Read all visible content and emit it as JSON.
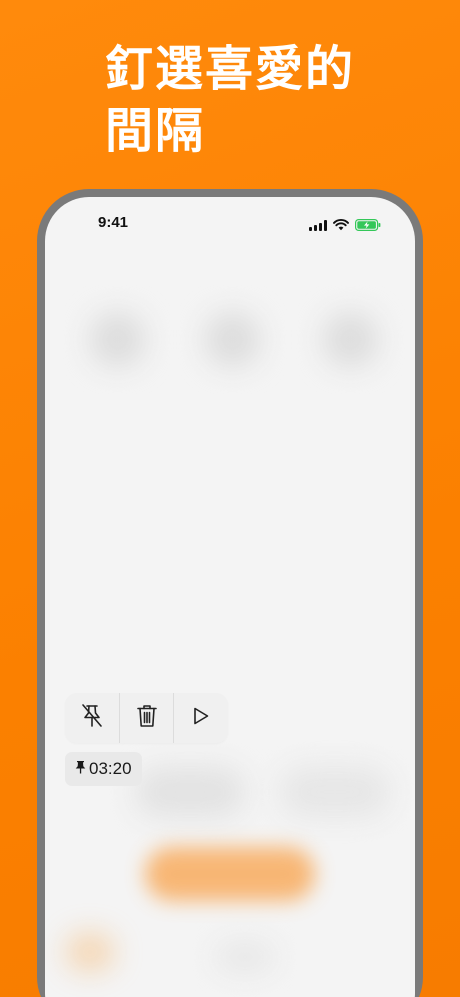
{
  "headline": {
    "line1": "釘選喜愛的",
    "line2": "間隔"
  },
  "status_bar": {
    "time": "9:41",
    "icons": [
      "cellular-signal-icon",
      "wifi-icon",
      "battery-charging-icon"
    ],
    "battery_color": "#34c759"
  },
  "context_actions": {
    "items": [
      {
        "name": "unpin-button",
        "icon": "unpin-icon"
      },
      {
        "name": "delete-button",
        "icon": "trash-icon"
      },
      {
        "name": "play-button",
        "icon": "play-icon"
      }
    ]
  },
  "pinned_interval": {
    "icon": "pin-icon",
    "value": "03:20"
  },
  "colors": {
    "background": "#fb8000",
    "frame": "#7a7a7a",
    "screen": "#f4f4f4",
    "accent_button": "#f9a24a"
  }
}
